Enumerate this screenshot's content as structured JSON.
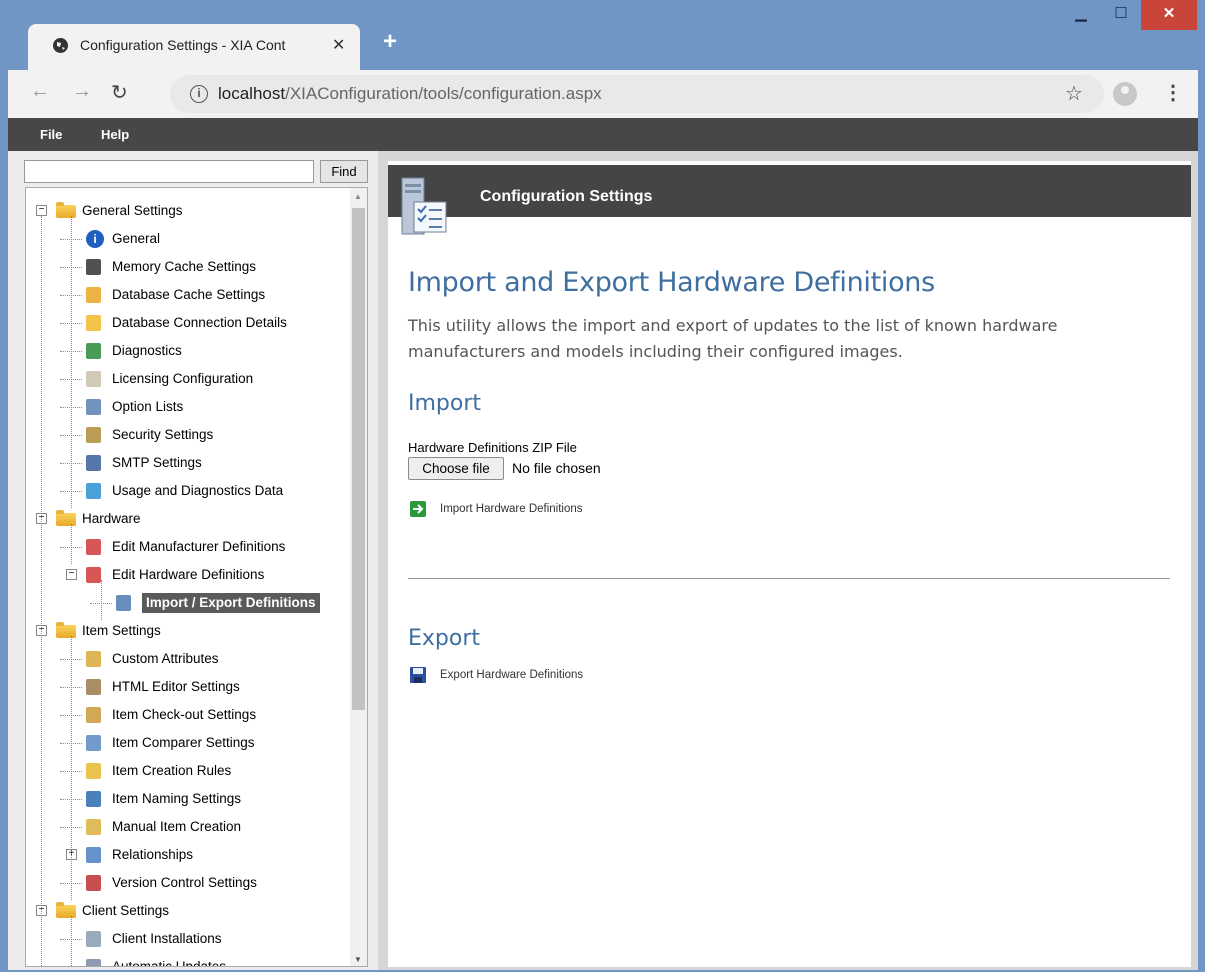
{
  "browser": {
    "tab_title": "Configuration Settings - XIA Cont",
    "url_host": "localhost",
    "url_path": "/XIAConfiguration/tools/configuration.aspx"
  },
  "menu": {
    "file": "File",
    "help": "Help"
  },
  "find": {
    "button": "Find",
    "value": ""
  },
  "tree": [
    {
      "label": "General Settings",
      "level": 0,
      "icon": "folder-icon",
      "expander": "−"
    },
    {
      "label": "General",
      "level": 1,
      "icon": "info-icon"
    },
    {
      "label": "Memory Cache Settings",
      "level": 1,
      "icon": "memory-icon"
    },
    {
      "label": "Database Cache Settings",
      "level": 1,
      "icon": "database-cache-icon"
    },
    {
      "label": "Database Connection Details",
      "level": 1,
      "icon": "database-icon"
    },
    {
      "label": "Diagnostics",
      "level": 1,
      "icon": "diagnostics-icon"
    },
    {
      "label": "Licensing Configuration",
      "level": 1,
      "icon": "license-icon"
    },
    {
      "label": "Option Lists",
      "level": 1,
      "icon": "list-icon"
    },
    {
      "label": "Security Settings",
      "level": 1,
      "icon": "keys-icon"
    },
    {
      "label": "SMTP Settings",
      "level": 1,
      "icon": "mail-icon"
    },
    {
      "label": "Usage and Diagnostics Data",
      "level": 1,
      "icon": "upload-icon"
    },
    {
      "label": "Hardware",
      "level": 0,
      "icon": "folder-icon",
      "expander": "−"
    },
    {
      "label": "Edit Manufacturer Definitions",
      "level": 1,
      "icon": "edit-doc-icon"
    },
    {
      "label": "Edit Hardware Definitions",
      "level": 1,
      "icon": "edit-doc-icon",
      "expander": "−"
    },
    {
      "label": "Import / Export Definitions",
      "level": 2,
      "icon": "import-export-icon",
      "selected": true
    },
    {
      "label": "Item Settings",
      "level": 0,
      "icon": "folder-icon",
      "expander": "−"
    },
    {
      "label": "Custom Attributes",
      "level": 1,
      "icon": "attributes-icon"
    },
    {
      "label": "HTML Editor Settings",
      "level": 1,
      "icon": "html-editor-icon"
    },
    {
      "label": "Item Check-out Settings",
      "level": 1,
      "icon": "checkout-icon"
    },
    {
      "label": "Item Comparer Settings",
      "level": 1,
      "icon": "compare-icon"
    },
    {
      "label": "Item Creation Rules",
      "level": 1,
      "icon": "creation-icon"
    },
    {
      "label": "Item Naming Settings",
      "level": 1,
      "icon": "naming-icon"
    },
    {
      "label": "Manual Item Creation",
      "level": 1,
      "icon": "manual-create-icon"
    },
    {
      "label": "Relationships",
      "level": 1,
      "icon": "relationships-icon",
      "expander": "+"
    },
    {
      "label": "Version Control Settings",
      "level": 1,
      "icon": "version-icon"
    },
    {
      "label": "Client Settings",
      "level": 0,
      "icon": "folder-icon",
      "expander": "−"
    },
    {
      "label": "Client Installations",
      "level": 1,
      "icon": "client-icon"
    },
    {
      "label": "Automatic Updates",
      "level": 1,
      "icon": "update-icon"
    }
  ],
  "panel": {
    "header_title": "Configuration Settings",
    "title": "Import and Export Hardware Definitions",
    "description": "This utility allows the import and export of updates to the list of known hardware manufacturers and models including their configured images.",
    "import_heading": "Import",
    "file_label": "Hardware Definitions ZIP File",
    "choose_file": "Choose file",
    "no_file": "No file chosen",
    "import_action": "Import Hardware Definitions",
    "export_heading": "Export",
    "export_action": "Export Hardware Definitions"
  },
  "colors": {
    "heading": "#3f6ea0",
    "header_bg": "#454545",
    "menubar_bg": "#474747",
    "selected_bg": "#5a5a5a"
  }
}
